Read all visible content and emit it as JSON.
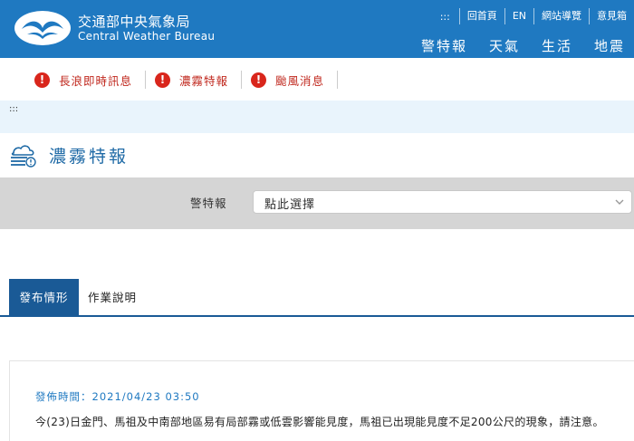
{
  "header": {
    "brand_zh": "交通部中央氣象局",
    "brand_en": "Central Weather Bureau",
    "utility": {
      "dots": ":::",
      "items": [
        "回首頁",
        "EN",
        "網站導覽",
        "意見箱"
      ]
    },
    "nav": [
      "警特報",
      "天氣",
      "生活",
      "地震"
    ],
    "colors": {
      "bar": "#1f79c1"
    }
  },
  "alerts": {
    "items": [
      {
        "icon": "!",
        "label": "長浪即時訊息"
      },
      {
        "icon": "!",
        "label": "濃霧特報"
      },
      {
        "icon": "!",
        "label": "颱風消息"
      }
    ],
    "colors": {
      "icon": "#d9261c",
      "label": "#c0281e"
    }
  },
  "breadcrumb": {
    "dots": ":::"
  },
  "page": {
    "title": "濃霧特報",
    "icon": "fog-warning-icon"
  },
  "filter": {
    "label": "警特報",
    "select_value": "點此選擇"
  },
  "tabs": [
    {
      "label": "發布情形",
      "active": true
    },
    {
      "label": "作業說明",
      "active": false
    }
  ],
  "content": {
    "issued_prefix": "發佈時間：",
    "issued_time": "2021/04/23 03:50",
    "message": "今(23)日金門、馬祖及中南部地區易有局部霧或低雲影響能見度，馬祖已出現能見度不足200公尺的現象，請注意。"
  }
}
